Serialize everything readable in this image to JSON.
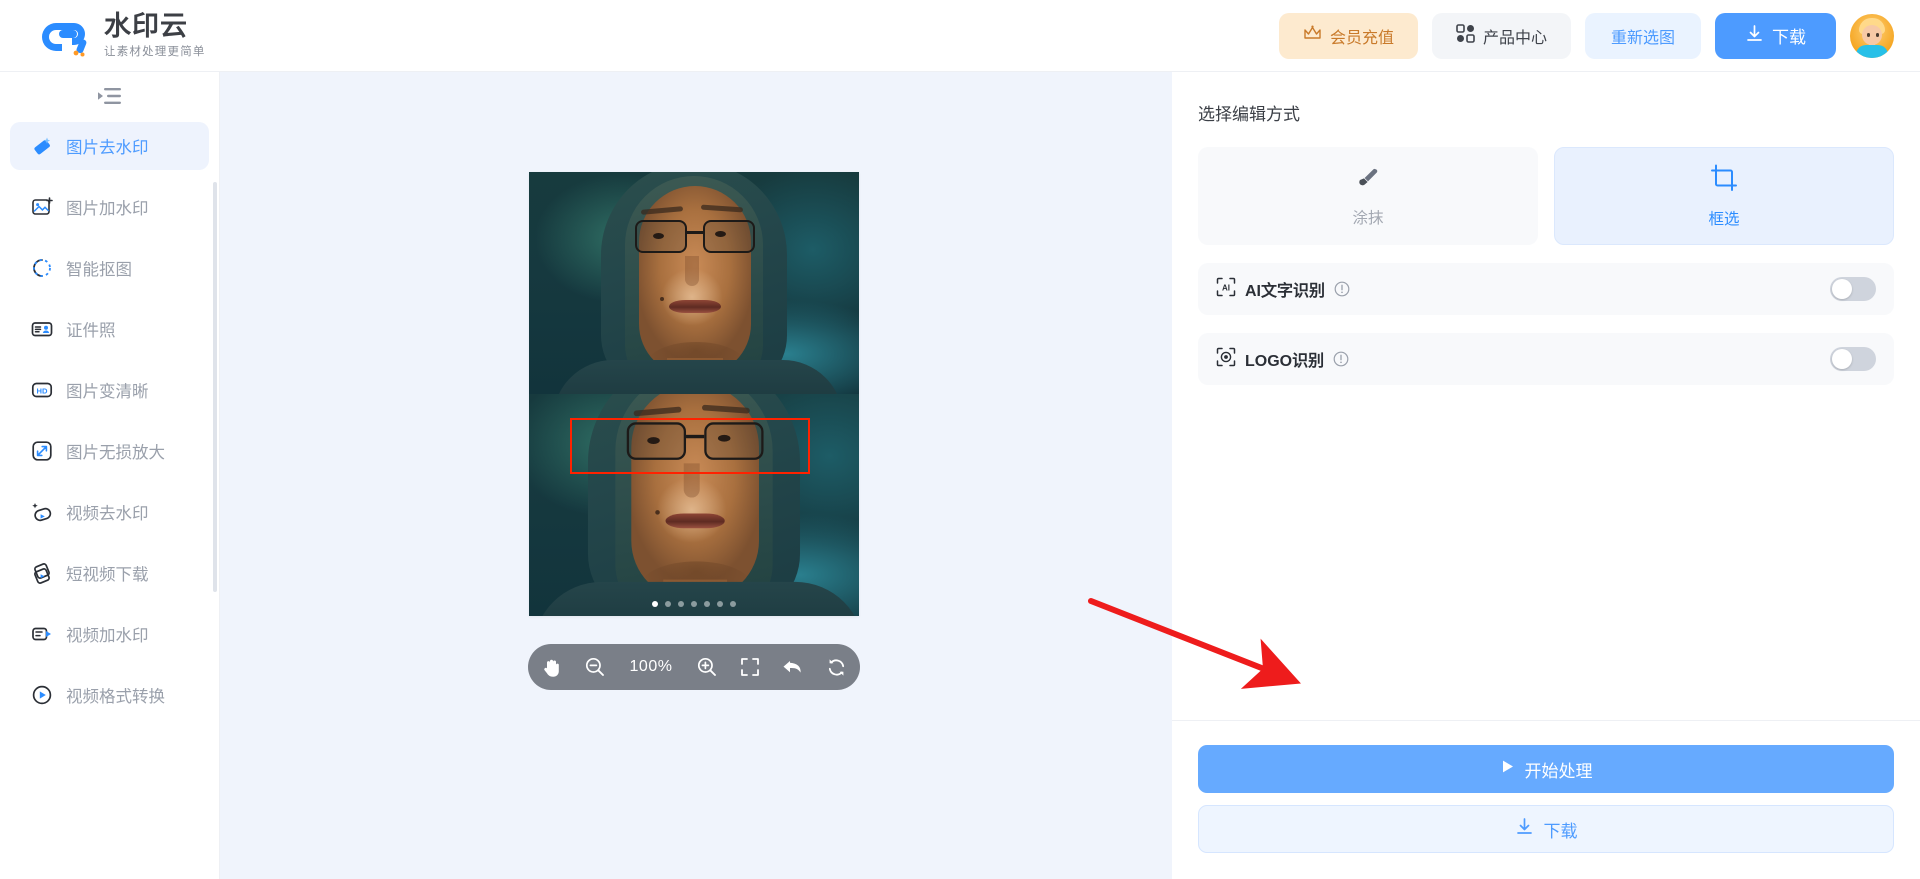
{
  "header": {
    "logo_title": "水印云",
    "logo_sub": "让素材处理更简单",
    "vip_label": "会员充值",
    "vip_icon": "crown-icon",
    "product_label": "产品中心",
    "product_icon": "grid-icon",
    "reselect_label": "重新选图",
    "download_label": "下载",
    "download_icon": "download-icon",
    "avatar_icon": "user-avatar"
  },
  "sidebar": {
    "collapse_icon": "collapse-menu-icon",
    "items": [
      {
        "label": "图片去水印",
        "icon": "eraser-icon",
        "active": true
      },
      {
        "label": "图片加水印",
        "icon": "image-add-icon",
        "active": false
      },
      {
        "label": "智能抠图",
        "icon": "cutout-icon",
        "active": false
      },
      {
        "label": "证件照",
        "icon": "id-photo-icon",
        "active": false
      },
      {
        "label": "图片变清晰",
        "icon": "hd-icon",
        "active": false
      },
      {
        "label": "图片无损放大",
        "icon": "enlarge-icon",
        "active": false
      },
      {
        "label": "视频去水印",
        "icon": "video-eraser-icon",
        "active": false
      },
      {
        "label": "短视频下载",
        "icon": "short-video-icon",
        "active": false
      },
      {
        "label": "视频加水印",
        "icon": "video-watermark-icon",
        "active": false
      },
      {
        "label": "视频格式转换",
        "icon": "video-convert-icon",
        "active": false
      }
    ]
  },
  "canvas": {
    "zoom_level": "100%",
    "toolbar": [
      {
        "name": "pan-tool",
        "icon": "hand-icon"
      },
      {
        "name": "zoom-out",
        "icon": "magnifier-minus-icon"
      },
      {
        "name": "zoom-value",
        "icon": ""
      },
      {
        "name": "zoom-in",
        "icon": "magnifier-plus-icon"
      },
      {
        "name": "fit-screen",
        "icon": "fullscreen-icon"
      },
      {
        "name": "undo",
        "icon": "undo-arrow-icon"
      },
      {
        "name": "reset",
        "icon": "refresh-icon"
      }
    ],
    "carousel_dots": 7,
    "carousel_active_index": 0,
    "selection_box_color": "#ff2200"
  },
  "panel": {
    "title": "选择编辑方式",
    "modes": [
      {
        "label": "涂抹",
        "icon": "brush-icon",
        "selected": false
      },
      {
        "label": "框选",
        "icon": "crop-box-icon",
        "selected": true
      }
    ],
    "options": [
      {
        "label": "AI文字识别",
        "icon": "ai-text-icon",
        "info_icon": "info-icon",
        "enabled": false
      },
      {
        "label": "LOGO识别",
        "icon": "logo-scan-icon",
        "info_icon": "info-icon",
        "enabled": false
      }
    ],
    "process_label": "开始处理",
    "process_icon": "play-icon",
    "download_label": "下载",
    "download_icon": "download-icon"
  },
  "annotation": {
    "arrow_color": "#ee1c1c"
  },
  "colors": {
    "accent": "#4d9bff",
    "accent_soft": "#eef3fd",
    "vip": "#c97a2a",
    "vip_bg": "#fdeacf",
    "canvas_bg": "#f0f4fc",
    "muted_text": "#9aa0ab"
  }
}
